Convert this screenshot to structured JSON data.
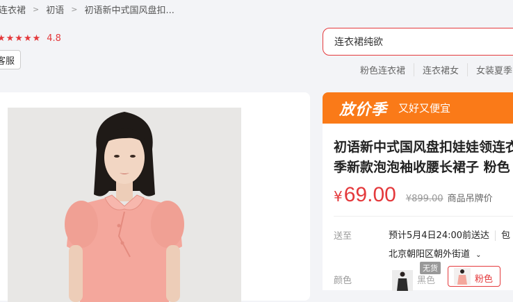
{
  "breadcrumb": [
    "连衣裙",
    "初语",
    "初语新中式国风盘扣..."
  ],
  "rating": {
    "stars": "★★★★★",
    "score": "4.8"
  },
  "service_btn": "客服",
  "search": {
    "value": "连衣裙纯欲"
  },
  "hot_searches": [
    "粉色连衣裙",
    "连衣裙女",
    "女装夏季"
  ],
  "promo": {
    "title": "放价季",
    "subtitle": "又好又便宜"
  },
  "product": {
    "title_line1": "初语新中式国风盘扣娃娃领连衣裙",
    "title_line2": "季新款泡泡袖收腰长裙子 粉色",
    "currency": "¥",
    "price": "69.00",
    "old_price": "¥899.00",
    "old_price_label": "商品吊牌价"
  },
  "delivery": {
    "label": "送至",
    "eta": "预计5月4日24:00前送达",
    "eta_more": "包",
    "address": "北京朝阳区朝外街道"
  },
  "color": {
    "label": "颜色",
    "sold_out": "无货",
    "options": [
      "黑色",
      "粉色"
    ]
  },
  "colors": {
    "accent": "#e4393c",
    "promo": "#fa7a18",
    "dress": "#f4a79c"
  }
}
